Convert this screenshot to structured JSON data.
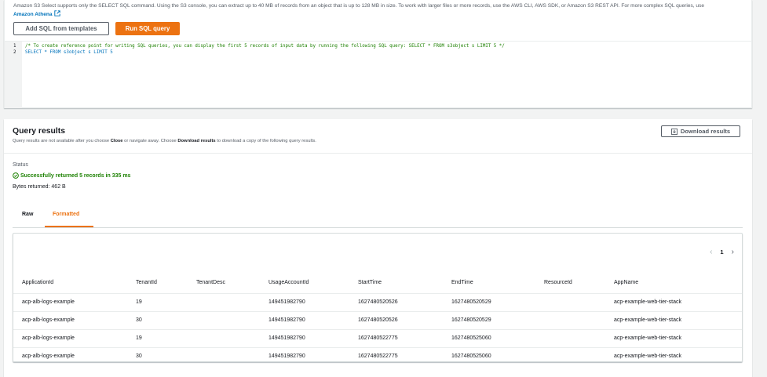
{
  "intro": {
    "text": "Amazon S3 Select supports only the SELECT SQL command. Using the S3 console, you can extract up to 40 MB of records from an object that is up to 128 MB in size. To work with larger files or more records, use the AWS CLI, AWS SDK, or Amazon S3 REST API. For more complex SQL queries, use",
    "link": "Amazon Athena"
  },
  "toolbar": {
    "add_sql_label": "Add SQL from templates",
    "run_sql_label": "Run SQL query"
  },
  "editor": {
    "lines": [
      {
        "num": "1",
        "text": "/* To create reference point for writing SQL queries, you can display the first 5 records of input data by running the following SQL query: SELECT * FROM s3object s LIMIT 5 */"
      },
      {
        "num": "2",
        "text": "SELECT * FROM s3object s LIMIT 5"
      }
    ]
  },
  "results": {
    "title": "Query results",
    "desc_pre": "Query results are not available after you choose ",
    "desc_close": "Close",
    "desc_mid": " or navigate away. Choose ",
    "desc_download": "Download results",
    "desc_post": " to download a copy of the following query results.",
    "download_label": "Download results",
    "status_label": "Status",
    "status_value": "Successfully returned 5 records in 335 ms",
    "bytes": "Bytes returned: 462 B",
    "tabs": [
      "Raw",
      "Formatted"
    ],
    "active_tab": "Formatted",
    "page": "1"
  },
  "table": {
    "columns": [
      "ApplicationId",
      "TenantId",
      "TenantDesc",
      "UsageAccountId",
      "StartTime",
      "EndTime",
      "ResourceId",
      "AppName"
    ],
    "rows": [
      [
        "acp-alb-logs-example",
        "19",
        "",
        "149451982790",
        "1627480520526",
        "1627480520529",
        "",
        "acp-example-web-tier-stack"
      ],
      [
        "acp-alb-logs-example",
        "30",
        "",
        "149451982790",
        "1627480520526",
        "1627480520529",
        "",
        "acp-example-web-tier-stack"
      ],
      [
        "acp-alb-logs-example",
        "19",
        "",
        "149451982790",
        "1627480522775",
        "1627480525060",
        "",
        "acp-example-web-tier-stack"
      ],
      [
        "acp-alb-logs-example",
        "30",
        "",
        "149451982790",
        "1627480522775",
        "1627480525060",
        "",
        "acp-example-web-tier-stack"
      ]
    ]
  },
  "colors": {
    "accent": "#ec7211",
    "link": "#0073bb",
    "success": "#1d8102"
  }
}
